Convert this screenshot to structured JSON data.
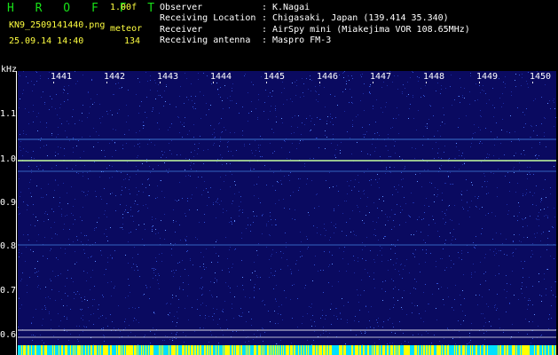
{
  "header": {
    "app_title": "H R O F F T",
    "version": "1.00f",
    "filename": "KN9_2509141440.png",
    "meteor_label": "meteor",
    "datetime": "25.09.14 14:40",
    "meteor_count": "134",
    "info": [
      {
        "key": "Observer",
        "value": "K.Nagai"
      },
      {
        "key": "Receiving Location",
        "value": "Chigasaki, Japan (139.414 35.340)"
      },
      {
        "key": "Receiver",
        "value": "AirSpy mini (Miakejima VOR 108.65MHz)"
      },
      {
        "key": "Receiving antenna",
        "value": "Maspro FM-3"
      }
    ]
  },
  "spectrogram": {
    "y_unit": "kHz",
    "y_labels": [
      "1.1",
      "1.0",
      "0.9",
      "0.8",
      "0.7",
      "0.6"
    ],
    "x_labels": [
      "1441",
      "1442",
      "1443",
      "1444",
      "1445",
      "1446",
      "1447",
      "1448",
      "1449",
      "1450"
    ],
    "colors": {
      "background": "#0a0a60",
      "carrier": "#c8ffa0",
      "noise": "#3050d0",
      "strip_a": "#ffff00",
      "strip_b": "#00e0ff"
    }
  }
}
